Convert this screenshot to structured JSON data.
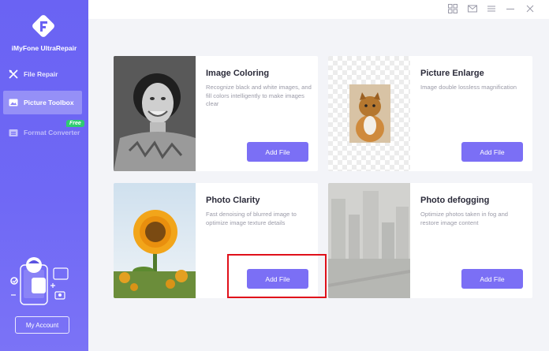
{
  "app": {
    "name": "iMyFone UltraRepair"
  },
  "sidebar": {
    "items": [
      {
        "label": "File Repair",
        "icon": "repair-tools-icon"
      },
      {
        "label": "Picture Toolbox",
        "icon": "image-icon"
      },
      {
        "label": "Format Converter",
        "icon": "convert-icon",
        "badge": "Free"
      }
    ],
    "account_label": "My Account"
  },
  "topbar": {
    "icons": [
      "grid-icon",
      "mail-icon",
      "menu-icon",
      "minimize-icon",
      "close-icon"
    ]
  },
  "cards": [
    {
      "title": "Image Coloring",
      "desc": "Recognize black and white images, and fill colors intelligently to make images clear",
      "button": "Add File"
    },
    {
      "title": "Picture Enlarge",
      "desc": "Image double lossless magnification",
      "button": "Add File"
    },
    {
      "title": "Photo Clarity",
      "desc": "Fast denoising of blurred image to optimize image texture details",
      "button": "Add File"
    },
    {
      "title": "Photo defogging",
      "desc": "Optimize photos taken in fog and restore image content",
      "button": "Add File"
    }
  ],
  "colors": {
    "sidebar": "#6a63f3",
    "accent_button": "#7b6ff5",
    "highlight": "#e0101a",
    "badge": "#2ecc71"
  }
}
